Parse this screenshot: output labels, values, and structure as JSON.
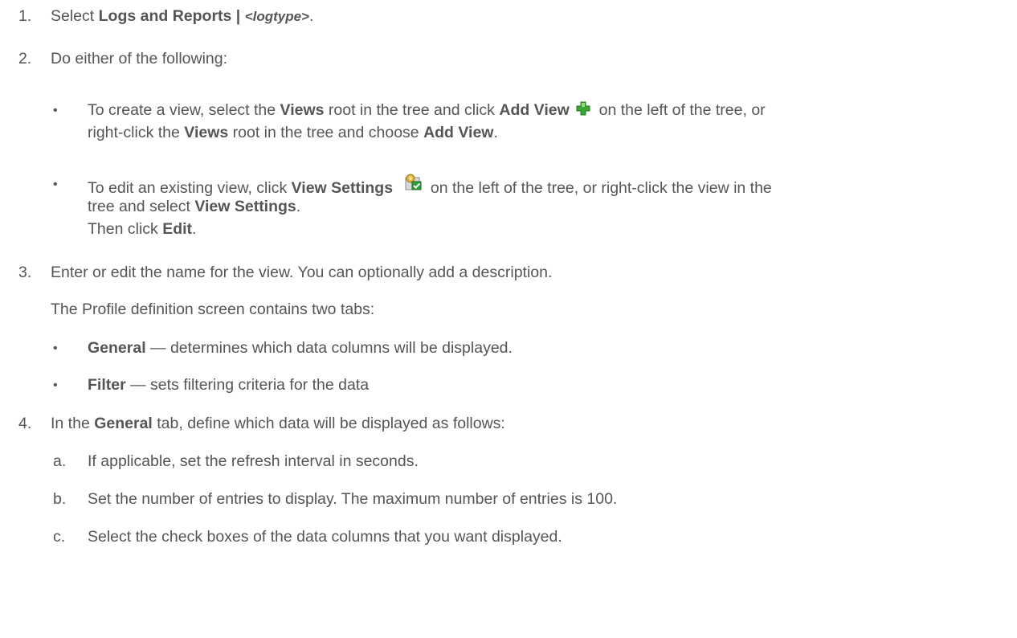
{
  "steps": {
    "s1": {
      "num": "1.",
      "pre": "Select ",
      "menu": "Logs and Reports | ",
      "menu_arg": "<logtype>",
      "post": "."
    },
    "s2": {
      "num": "2.",
      "text": "Do either of the following:",
      "opt_create": {
        "l1": {
          "a": "To create a view, select the ",
          "b": "Views",
          "c": " root in the tree and click ",
          "d": "Add View",
          "e": " on the left of the tree, or"
        },
        "l2": {
          "a": "right-click the ",
          "b": "Views",
          "c": " root in the tree and choose ",
          "d": "Add View",
          "e": "."
        }
      },
      "opt_edit": {
        "l1": {
          "a": "To edit an existing view, click ",
          "b": "View Settings",
          "c": " on the left of the tree, or right-click the view in the"
        },
        "l2": {
          "a": "tree and select ",
          "b": "View Settings",
          "c": "."
        },
        "l3": {
          "a": "Then click ",
          "b": "Edit",
          "c": "."
        }
      }
    },
    "s3": {
      "num": "3.",
      "text": "Enter or edit the name for the view. You can optionally add a description.",
      "intro": "The Profile definition screen contains two tabs:",
      "tab_general": {
        "name": "General",
        "desc": " — determines which data columns will be displayed."
      },
      "tab_filter": {
        "name": "Filter",
        "desc": " — sets filtering criteria for the data"
      }
    },
    "s4": {
      "num": "4.",
      "a": "In the ",
      "b": "General",
      "c": " tab, define which data will be displayed as follows:",
      "sub_a": {
        "label": "a.",
        "text": "If applicable, set the refresh interval in seconds."
      },
      "sub_b": {
        "label": "b.",
        "text": "Set the number of entries to display. The maximum number of entries is 100."
      },
      "sub_c": {
        "label": "c.",
        "text": "Select the check boxes of the data columns that you want displayed."
      }
    }
  },
  "bullet": "•",
  "icons": {
    "add": "add-view-icon",
    "settings": "view-settings-icon"
  },
  "colors": {
    "text": "#555555",
    "add_green": "#3aa635",
    "settings_green": "#2e9e3a"
  }
}
